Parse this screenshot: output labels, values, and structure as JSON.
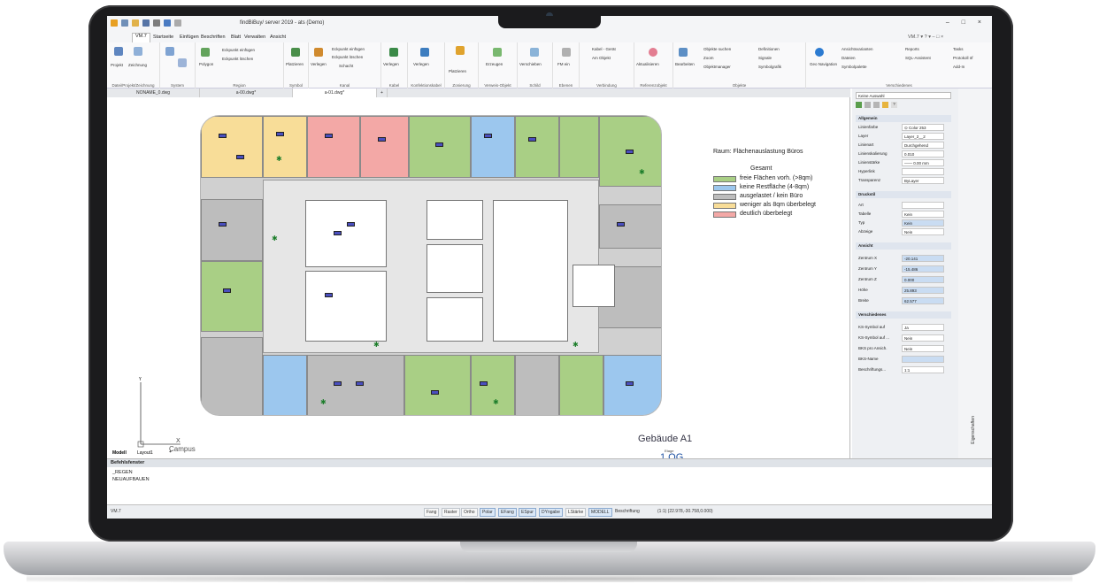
{
  "app": {
    "title": "findBiBuy/ server 2019 - ats (Demo)"
  },
  "ribbon_tabs": [
    "VM.7",
    "Startseite",
    "Einfügen",
    "Beschriften",
    "Blatt",
    "Verwalten",
    "Ansicht"
  ],
  "ribbon_groups": {
    "g1": {
      "label": "Datei/Projekt/Zeichnung",
      "items": [
        "Projekt",
        "Zeichnung"
      ]
    },
    "g2": {
      "label": "System"
    },
    "g3": {
      "label": "Region",
      "items": [
        "Polygon",
        "Eckpunkt einfügen",
        "Eckpunkt löschen"
      ]
    },
    "g4": {
      "label": "Symbol",
      "items": [
        "Platzieren"
      ]
    },
    "g5": {
      "label": "Kanal",
      "items": [
        "Verlegen",
        "Eckpunkt einfügen",
        "Eckpunkt löschen",
        "Schacht"
      ]
    },
    "g6": {
      "label": "Kabel",
      "items": [
        "Verlegen"
      ]
    },
    "g7": {
      "label": "Konfektionskabel",
      "items": [
        "Verlegen"
      ]
    },
    "g8": {
      "label": "Zonierung",
      "items": [
        "Platzieren"
      ]
    },
    "g9": {
      "label": "Verweis-Objekt",
      "items": [
        "Erzeugen"
      ]
    },
    "g10": {
      "label": "Schild",
      "items": [
        "Verschieben"
      ]
    },
    "g11": {
      "label": "Ebenen",
      "items": [
        "FM ein"
      ]
    },
    "g12": {
      "label": "Verbindung",
      "items": [
        "Kabel - Gerät",
        "Am Objekt"
      ]
    },
    "g13": {
      "label": "Referenzobjekt",
      "items": [
        "Aktualisieren"
      ]
    },
    "g14": {
      "label": "Objekte",
      "items": [
        "Bearbeiten",
        "Objekte suchen",
        "Zoom",
        "Objektmanager",
        "Definitionen",
        "Signale",
        "Symbolgrafik"
      ]
    },
    "g15": {
      "label": "Verschiedenes",
      "items": [
        "Geo Navigation",
        "Ansichtsvarianten",
        "Dateien",
        "Symbolpalette",
        "Reports",
        "SQL-Assistent",
        "Tasks",
        "Protokoll öf",
        "Add-In"
      ]
    }
  },
  "doc_tabs": [
    "NONAME_0.dwg",
    "a-00.dwg*",
    "a-01.dwg*"
  ],
  "layout_tabs": [
    "Modell",
    "Layout1"
  ],
  "legend": {
    "title": "Raum: Flächenauslastung Büros",
    "subtitle": "Gesamt",
    "items": [
      {
        "color": "#a9cf85",
        "label": "freie Flächen vorh. (>8qm)"
      },
      {
        "color": "#9cc7ee",
        "label": "keine Restfläche (4-8qm)"
      },
      {
        "color": "#bdbdbd",
        "label": "ausgelastet / kein Büro"
      },
      {
        "color": "#f8dd98",
        "label": "weniger als 8qm überbelegt"
      },
      {
        "color": "#f3a8a6",
        "label": "deutlich überbelegt"
      }
    ]
  },
  "building": {
    "name": "Gebäude A1",
    "sub": "Etage",
    "floor": "1.OG"
  },
  "ucs_label": "Campus",
  "properties": {
    "selector": "Keine Auswahl",
    "sections": {
      "allgemein": "Allgemein",
      "druckstil": "Druckstil",
      "ansicht": "Ansicht",
      "verschiedenes": "Verschiedenes"
    },
    "allgemein": [
      {
        "k": "Linienfarbe",
        "v": "⊙ Color 253"
      },
      {
        "k": "Layer",
        "v": "Layer_2__2"
      },
      {
        "k": "Linienart",
        "v": "Durchgehend"
      },
      {
        "k": "Linienskalierung",
        "v": "0.010"
      },
      {
        "k": "Linienstärke",
        "v": "—— 0.00 mm"
      },
      {
        "k": "Hyperlink",
        "v": ""
      },
      {
        "k": "Transparenz",
        "v": "ByLayer"
      }
    ],
    "druckstil": [
      {
        "k": "Art",
        "v": ""
      },
      {
        "k": "Tabelle",
        "v": "Kein"
      },
      {
        "k": "Typ",
        "v": "Kein"
      },
      {
        "k": "Abzeige",
        "v": "Nein"
      }
    ],
    "ansicht": [
      {
        "k": "Zentrum X",
        "v": "-20.141"
      },
      {
        "k": "Zentrum Y",
        "v": "-15.486"
      },
      {
        "k": "Zentrum Z",
        "v": "0.000"
      },
      {
        "k": "Höhe",
        "v": "25.893"
      },
      {
        "k": "Breite",
        "v": "62.577"
      }
    ],
    "verschiedenes": [
      {
        "k": "KS-Symbol auf",
        "v": "Ja"
      },
      {
        "k": "KS-Symbol auf ...",
        "v": "Nein"
      },
      {
        "k": "BKS pro Ansich.",
        "v": "Nein"
      },
      {
        "k": "BKS-Name",
        "v": ""
      },
      {
        "k": "Beschriftungs...",
        "v": "1:1"
      }
    ],
    "side_label": "Eigenschaften"
  },
  "command": {
    "title": "Befehlsfenster",
    "lines": [
      "_REGEN",
      "NEUAUFBAUEN"
    ]
  },
  "status": {
    "left": "VM.7",
    "buttons": [
      "Fang",
      "Raster",
      "Ortho",
      "Polar",
      "EFang",
      "ESpur",
      "DYngabe",
      "LStärke",
      "MODELL",
      "Beschriftung"
    ],
    "coords": "(1:1)  (22.978,-30.758,0.000)"
  }
}
